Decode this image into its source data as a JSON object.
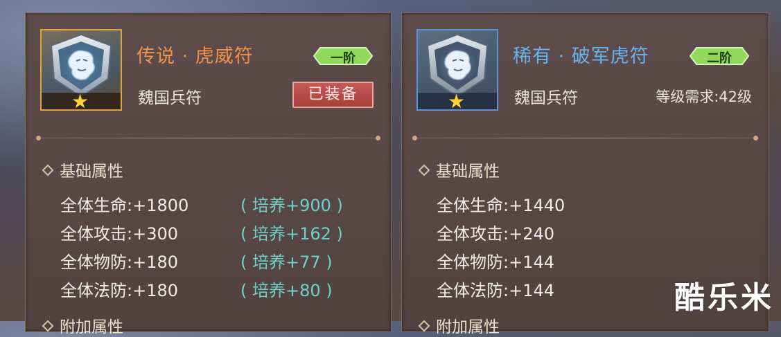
{
  "left_card": {
    "name": "传说 · 虎威符",
    "tier": "一阶",
    "type": "魏国兵符",
    "equipped_label": "已装备",
    "section_title": "基础属性",
    "stats": [
      {
        "label": "全体生命:+1800",
        "bonus": "( 培养+900 )"
      },
      {
        "label": "全体攻击:+300",
        "bonus": "( 培养+162 )"
      },
      {
        "label": "全体物防:+180",
        "bonus": "( 培养+77 )"
      },
      {
        "label": "全体法防:+180",
        "bonus": "( 培养+80 )"
      }
    ],
    "next_section": "附加属性",
    "star_count": 1,
    "frame_color": "#e0a43a"
  },
  "right_card": {
    "name": "稀有 · 破军虎符",
    "tier": "二阶",
    "type": "魏国兵符",
    "requirement": "等级需求:42级",
    "section_title": "基础属性",
    "stats": [
      {
        "label": "全体生命:+1440"
      },
      {
        "label": "全体攻击:+240"
      },
      {
        "label": "全体物防:+144"
      },
      {
        "label": "全体法防:+144"
      }
    ],
    "next_section": "附加属性",
    "star_count": 1,
    "frame_color": "#5d93d8"
  },
  "watermark": "酷乐米",
  "colors": {
    "legend_name": "#f0924a",
    "rare_name": "#66b4f0",
    "bonus_text": "#6fd0c6",
    "tier_badge": "#7fcf4a"
  }
}
